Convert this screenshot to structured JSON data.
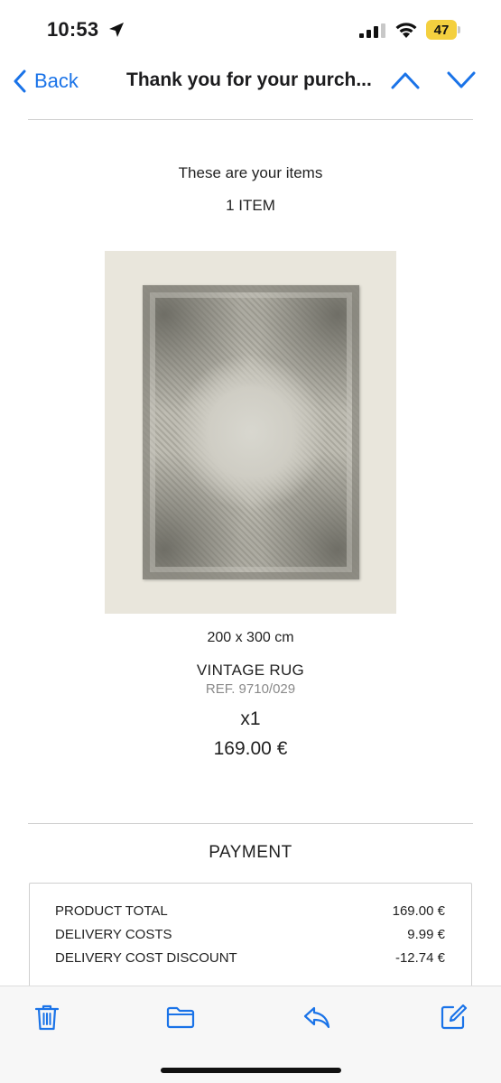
{
  "status": {
    "time": "10:53",
    "battery": "47"
  },
  "nav": {
    "back_label": "Back",
    "title": "Thank you for your purch..."
  },
  "order": {
    "items_heading": "These are your items",
    "items_count": "1 ITEM",
    "product": {
      "size": "200 x 300 cm",
      "name": "VINTAGE RUG",
      "ref": "REF. 9710/029",
      "quantity": "x1",
      "price": "169.00 €"
    }
  },
  "payment": {
    "heading": "PAYMENT",
    "rows": [
      {
        "label": "PRODUCT TOTAL",
        "value": "169.00 €"
      },
      {
        "label": "DELIVERY COSTS",
        "value": "9.99 €"
      },
      {
        "label": "DELIVERY COST DISCOUNT",
        "value": "-12.74 €"
      }
    ]
  },
  "toolbar": {
    "icons": [
      "trash-icon",
      "folder-icon",
      "reply-icon",
      "compose-icon"
    ]
  },
  "colors": {
    "accent": "#1a73e8",
    "battery": "#f4d03f"
  }
}
